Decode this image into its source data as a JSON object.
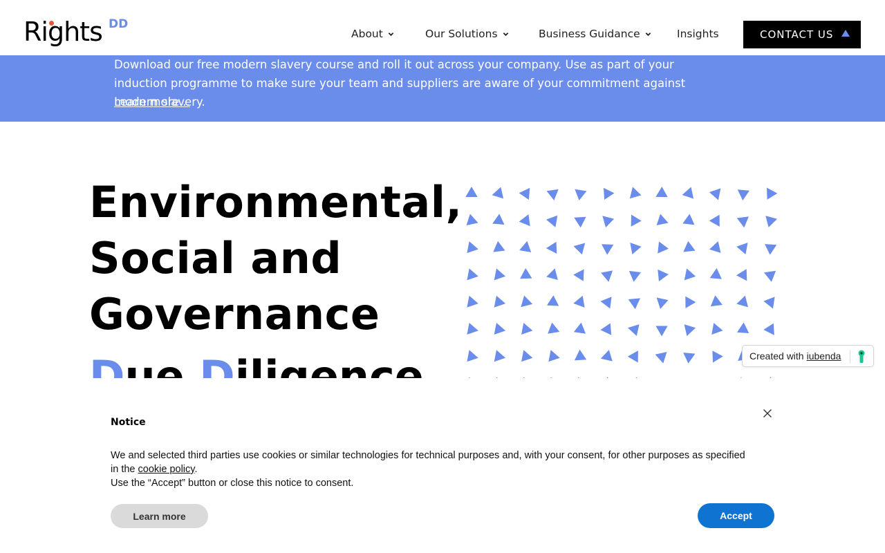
{
  "header": {
    "logo_text": "Rights",
    "logo_sup": "DD",
    "nav": [
      {
        "label": "About",
        "has_dropdown": true
      },
      {
        "label": "Our Solutions",
        "has_dropdown": true
      },
      {
        "label": "Business Guidance",
        "has_dropdown": true
      },
      {
        "label": "Insights",
        "has_dropdown": false
      }
    ],
    "contact_label": "CONTACT US"
  },
  "banner": {
    "text": "Download our free modern slavery course and roll it out across your company. Use as part of your induction programme to make sure your team and suppliers are aware of your commitment against modern slavery.",
    "link": "Learn more..."
  },
  "hero": {
    "line1": "Environmental,",
    "line2": "Social and",
    "line3": "Governance",
    "line4_a": "D",
    "line4_b": "ue ",
    "line4_c": "D",
    "line4_d": "iligence"
  },
  "iubenda": {
    "prefix": "Created with",
    "link": "iubenda"
  },
  "cookie_notice": {
    "title": "Notice",
    "body_1": "We and selected third parties use cookies or similar technologies for technical purposes and, with your consent, for other purposes as specified in the ",
    "body_link": "cookie policy",
    "body_2": ".",
    "body_3": "Use the “Accept” button or close this notice to consent.",
    "learn_more": "Learn more",
    "accept": "Accept"
  },
  "colors": {
    "accent": "#6a8cea",
    "accept_button": "#0f73d2",
    "logo_dot": "#e8573a"
  }
}
